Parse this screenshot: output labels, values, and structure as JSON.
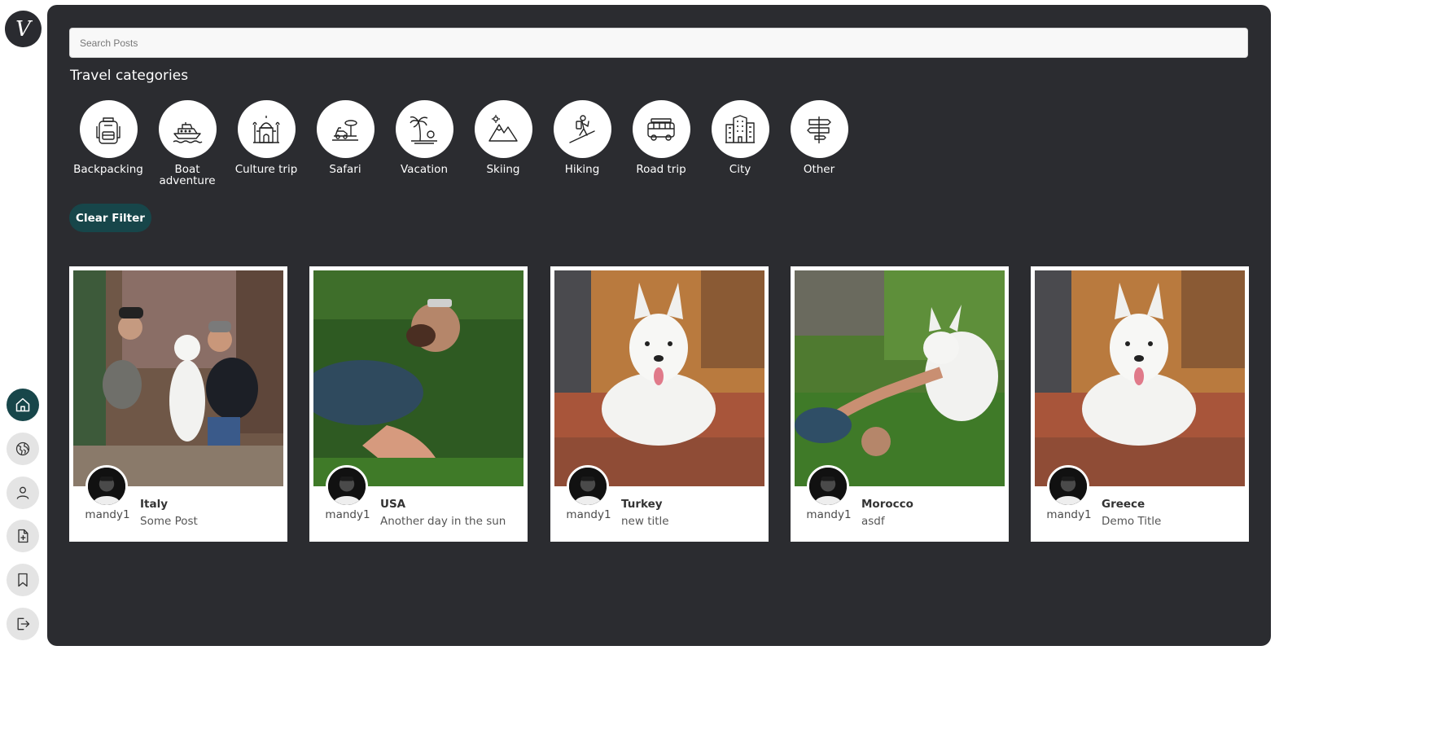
{
  "app": {
    "logo_letter": "V"
  },
  "nav": [
    {
      "name": "home-icon",
      "active": true
    },
    {
      "name": "globe-icon",
      "active": false
    },
    {
      "name": "profile-icon",
      "active": false
    },
    {
      "name": "new-post-icon",
      "active": false
    },
    {
      "name": "bookmark-icon",
      "active": false
    },
    {
      "name": "logout-icon",
      "active": false
    }
  ],
  "search": {
    "placeholder": "Search Posts",
    "value": ""
  },
  "categories_title": "Travel categories",
  "categories": [
    {
      "label": "Backpacking",
      "icon": "backpack-icon"
    },
    {
      "label": "Boat adventure",
      "icon": "boat-icon"
    },
    {
      "label": "Culture trip",
      "icon": "mosque-icon"
    },
    {
      "label": "Safari",
      "icon": "safari-icon"
    },
    {
      "label": "Vacation",
      "icon": "palm-tree-icon"
    },
    {
      "label": "Skiing",
      "icon": "mountain-icon"
    },
    {
      "label": "Hiking",
      "icon": "hiker-icon"
    },
    {
      "label": "Road trip",
      "icon": "van-icon"
    },
    {
      "label": "City",
      "icon": "buildings-icon"
    },
    {
      "label": "Other",
      "icon": "signpost-icon"
    }
  ],
  "clear_filter_label": "Clear Filter",
  "posts": [
    {
      "title": "Italy",
      "subtitle": "Some Post",
      "author": "mandy1",
      "image": "couple-with-dog"
    },
    {
      "title": "USA",
      "subtitle": "Another day in the sun",
      "author": "mandy1",
      "image": "man-lying-in-grass"
    },
    {
      "title": "Turkey",
      "subtitle": "new title",
      "author": "mandy1",
      "image": "white-dog-on-steps"
    },
    {
      "title": "Morocco",
      "subtitle": "asdf",
      "author": "mandy1",
      "image": "man-with-dog-in-garden"
    },
    {
      "title": "Greece",
      "subtitle": "Demo Title",
      "author": "mandy1",
      "image": "white-dog-on-steps"
    }
  ],
  "colors": {
    "panel": "#2b2c30",
    "accent": "#17464a",
    "nav_inactive": "#e4e4e4",
    "text_light": "#ffffff"
  }
}
